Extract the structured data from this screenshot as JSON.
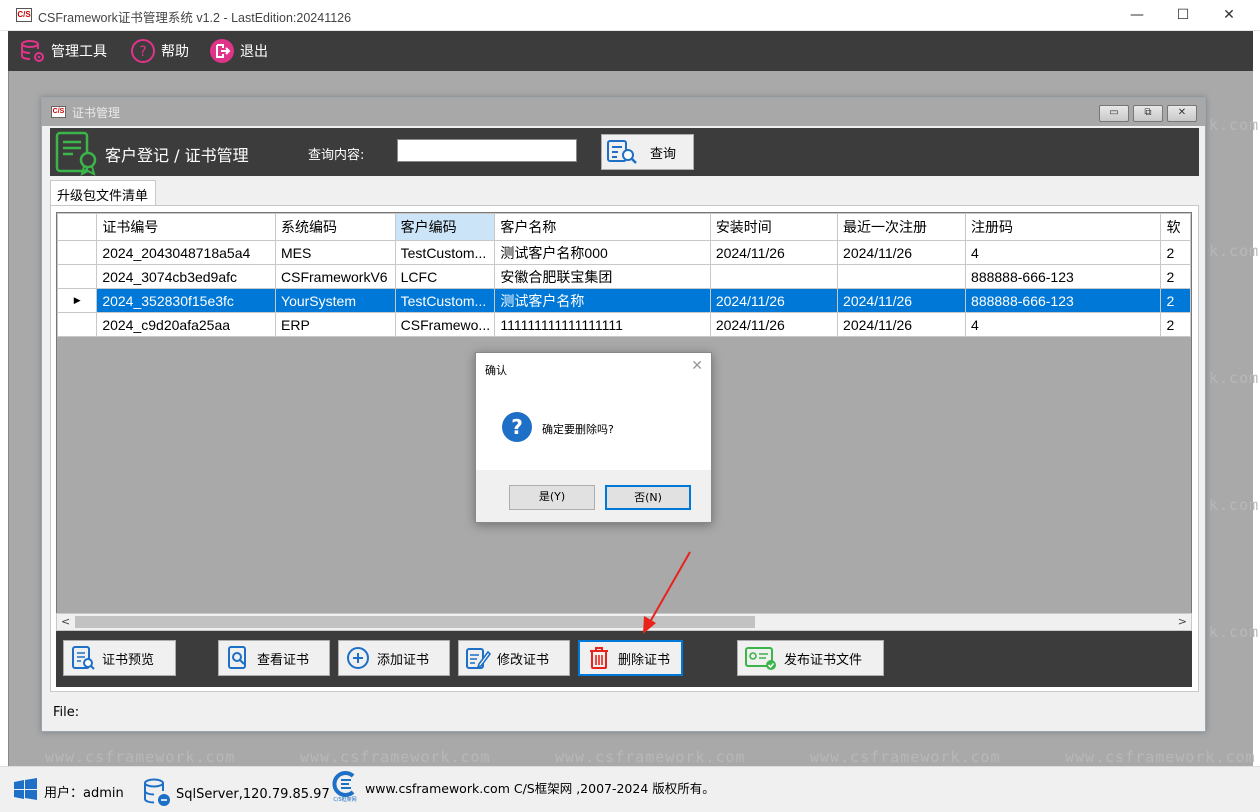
{
  "window": {
    "app_icon": "C/S",
    "title": "CSFramework证书管理系统 v1.2 - LastEdition:20241126",
    "minimize": "—",
    "maximize": "☐",
    "close": "✕"
  },
  "menu": [
    {
      "label": "管理工具",
      "icon": "database-gear-icon"
    },
    {
      "label": "帮助",
      "icon": "help-circle-icon"
    },
    {
      "label": "退出",
      "icon": "exit-icon"
    }
  ],
  "watermark": "www.csframework.com",
  "watermark_right": "k.com",
  "child_window": {
    "icon": "C/S",
    "title": "证书管理",
    "header_title": "客户登记 / 证书管理",
    "query_label": "查询内容:",
    "query_value": "",
    "query_button": "查询",
    "tab_label": "升级包文件清单"
  },
  "grid": {
    "columns": [
      "证书编号",
      "系统编码",
      "客户编码",
      "客户名称",
      "安装时间",
      "最近一次注册",
      "注册码",
      "软"
    ],
    "rows": [
      [
        "2024_2043048718a5a4",
        "MES",
        "TestCustom...",
        "测试客户名称000",
        "2024/11/26",
        "2024/11/26",
        "4",
        "2"
      ],
      [
        "2024_3074cb3ed9afc",
        "CSFrameworkV6",
        "LCFC",
        "安徽合肥联宝集团",
        "",
        "",
        "888888-666-123",
        "2"
      ],
      [
        "2024_352830f15e3fc",
        "YourSystem",
        "TestCustom...",
        "测试客户名称",
        "2024/11/26",
        "2024/11/26",
        "888888-666-123",
        "2"
      ],
      [
        "2024_c9d20afa25aa",
        "ERP",
        "CSFramewo...",
        "111111111111111111",
        "2024/11/26",
        "2024/11/26",
        "4",
        "2"
      ]
    ],
    "selected_row": 2,
    "highlighted_column": 2
  },
  "toolbar": [
    {
      "label": "证书预览",
      "icon": "certificate-preview-icon"
    },
    {
      "label": "查看证书",
      "icon": "view-certificate-icon"
    },
    {
      "label": "添加证书",
      "icon": "add-icon"
    },
    {
      "label": "修改证书",
      "icon": "edit-certificate-icon"
    },
    {
      "label": "删除证书",
      "icon": "trash-icon"
    },
    {
      "label": "发布证书文件",
      "icon": "publish-certificate-icon"
    }
  ],
  "file_status": "File:",
  "status_bar": {
    "user": "用户：admin",
    "server": "SqlServer,120.79.85.97",
    "logo_caption": "C/S框架网",
    "copyright": "www.csframework.com C/S框架网 ,2007-2024 版权所有。"
  },
  "dialog": {
    "title": "确认",
    "message": "确定要删除吗?",
    "yes": "是(Y)",
    "no": "否(N)"
  },
  "colors": {
    "dark_bar": "#3c3c3c",
    "selection": "#0078d7",
    "desktop": "#a9a9a9",
    "annotation_arrow": "#e8231b"
  }
}
